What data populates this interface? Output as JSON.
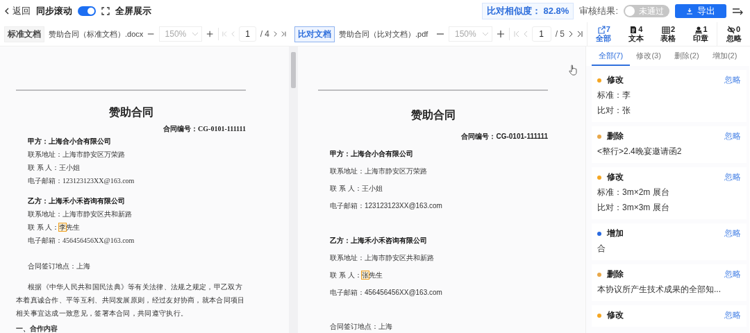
{
  "top_bar": {
    "back": "返回",
    "sync_scroll": {
      "label": "同步滚动",
      "on": true
    },
    "fullscreen": "全屏展示",
    "similarity": "比对相似度： 82.8%",
    "review": {
      "label": "审核结果:",
      "value": "未通过",
      "on": false
    },
    "export": "导出"
  },
  "panes": [
    {
      "kind": "standard",
      "badge": "标准文档",
      "file": "赞助合同（标准文档）.docx",
      "zoom": {
        "value": "150%",
        "disabled": true
      },
      "pager": {
        "page": "1",
        "of": "/ 4",
        "can_go_back": false,
        "can_go_forward": true
      },
      "doc": {
        "title": "赞助合同",
        "number": "合同编号：CG-0101-111111",
        "lines": [
          {
            "kind": "party",
            "text": "甲方：上海合小合有限公司"
          },
          {
            "kind": "field",
            "text": "联系地址：上海市静安区万荣路"
          },
          {
            "kind": "field",
            "text": "联 系 人：王小姐"
          },
          {
            "kind": "field",
            "text": "电子邮箱：123123123XX@163.com"
          },
          {
            "kind": "party",
            "text": "乙方：上海禾小禾咨询有限公司"
          },
          {
            "kind": "field",
            "text": "联系地址：上海市静安区共和新路"
          },
          {
            "kind": "field",
            "segments": [
              {
                "text": "联 系 人：",
                "highlighted": false
              },
              {
                "text": "李",
                "highlighted": true
              },
              {
                "text": "先生",
                "highlighted": false
              }
            ]
          },
          {
            "kind": "field",
            "text": "电子邮箱：456456456XX@163.com"
          },
          {
            "kind": "place",
            "text": "合同签订地点：上海"
          },
          {
            "kind": "para",
            "text": "根据《中华人民共和国民法典》等有关法律、法规之规定，甲乙双方本着真诚合作、平等互利、共同发展原则，经过友好协商，就本合同项目相关事宜达成一致意见，签署本合同，共同遵守执行。"
          },
          {
            "kind": "section",
            "text": "一、合作内容"
          }
        ]
      }
    },
    {
      "kind": "compare",
      "badge": "比对文档",
      "file": "赞助合同（比对文档）.pdf",
      "zoom": {
        "value": "150%",
        "disabled": true
      },
      "pager": {
        "page": "1",
        "of": "/ 5",
        "can_go_back": false,
        "can_go_forward": true
      },
      "doc": {
        "title": "赞助合同",
        "number": "合同编号：CG-0101-111111",
        "lines": [
          {
            "kind": "party",
            "text": "甲方：上海合小合有限公司"
          },
          {
            "kind": "field",
            "text": "联系地址：上海市静安区万荣路"
          },
          {
            "kind": "field",
            "text": "联 系 人：王小姐"
          },
          {
            "kind": "field",
            "text": "电子邮箱：123123123XX@163.com"
          },
          {
            "kind": "party",
            "text": "乙方：上海禾小禾咨询有限公司"
          },
          {
            "kind": "field",
            "text": "联系地址：上海市静安区共和新路"
          },
          {
            "kind": "field",
            "segments": [
              {
                "text": "联 系 人：",
                "highlighted": false
              },
              {
                "text": "张",
                "highlighted": true
              },
              {
                "text": "先生",
                "highlighted": false
              }
            ]
          },
          {
            "kind": "field",
            "text": "电子邮箱：456456456XX@163.com"
          },
          {
            "kind": "place",
            "text": "合同签订地点：上海"
          }
        ]
      }
    }
  ],
  "sidebar": {
    "categories": [
      {
        "kind": "all",
        "count": "7",
        "label": "全部",
        "selected": true
      },
      {
        "kind": "text",
        "count": "4",
        "label": "文本",
        "selected": false
      },
      {
        "kind": "table",
        "count": "2",
        "label": "表格",
        "selected": false
      },
      {
        "kind": "seal",
        "count": "1",
        "label": "印章",
        "selected": false
      },
      {
        "kind": "ignored",
        "count": "0",
        "label": "忽略",
        "selected": false
      }
    ],
    "tabs": [
      {
        "label": "全部(7)",
        "selected": true
      },
      {
        "label": "修改(3)",
        "selected": false
      },
      {
        "label": "删除(2)",
        "selected": false
      },
      {
        "label": "增加(2)",
        "selected": false
      }
    ],
    "changes": [
      {
        "type": "修改",
        "color": "#f5a623",
        "action": "忽略",
        "lines": [
          "标准：李",
          "比对：张"
        ]
      },
      {
        "type": "删除",
        "color": "#e8a84a",
        "action": "忽略",
        "lines": [
          "<整行>2.4晚宴邀请函2"
        ]
      },
      {
        "type": "修改",
        "color": "#f5a623",
        "action": "忽略",
        "lines": [
          "标准：3m×2m 展台",
          "比对：3m×3m 展台"
        ]
      },
      {
        "type": "增加",
        "color": "#2a6ae0",
        "action": "忽略",
        "lines": [
          "合"
        ]
      },
      {
        "type": "删除",
        "color": "#e8a84a",
        "action": "忽略",
        "lines": [
          "本协议所产生技术成果的全部知..."
        ]
      },
      {
        "type": "修改",
        "color": "#f5a623",
        "action": "忽略"
      }
    ]
  }
}
